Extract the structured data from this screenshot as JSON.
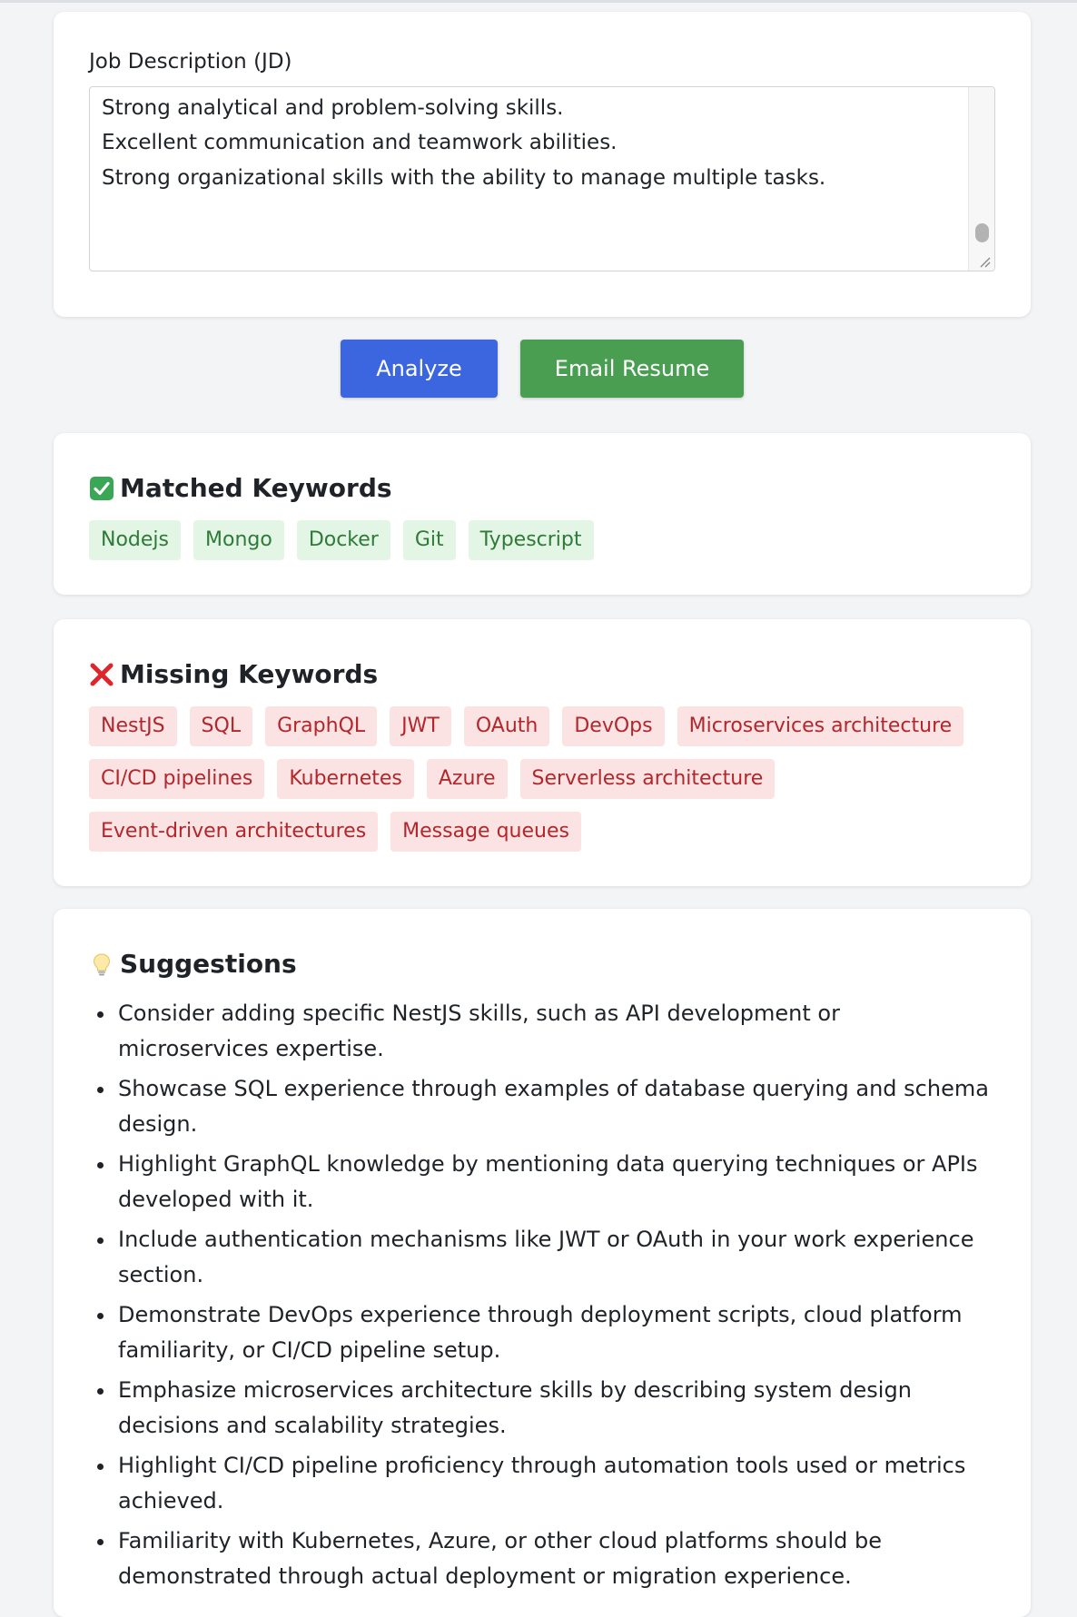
{
  "jd": {
    "label": "Job Description (JD)",
    "text": "Overview\n\nSoft Skills:\n\nStrong analytical and problem-solving skills.\nExcellent communication and teamwork abilities.\nStrong organizational skills with the ability to manage multiple tasks."
  },
  "actions": {
    "analyze_label": "Analyze",
    "email_label": "Email Resume"
  },
  "matched": {
    "title": "Matched Keywords",
    "icon": "check-mark-icon",
    "keywords": [
      "Nodejs",
      "Mongo",
      "Docker",
      "Git",
      "Typescript"
    ]
  },
  "missing": {
    "title": "Missing Keywords",
    "icon": "cross-mark-icon",
    "keywords": [
      "NestJS",
      "SQL",
      "GraphQL",
      "JWT",
      "OAuth",
      "DevOps",
      "Microservices architecture",
      "CI/CD pipelines",
      "Kubernetes",
      "Azure",
      "Serverless architecture",
      "Event-driven architectures",
      "Message queues"
    ]
  },
  "suggestions": {
    "title": "Suggestions",
    "icon": "lightbulb-icon",
    "items": [
      "Consider adding specific NestJS skills, such as API development or microservices expertise.",
      "Showcase SQL experience through examples of database querying and schema design.",
      "Highlight GraphQL knowledge by mentioning data querying techniques or APIs developed with it.",
      "Include authentication mechanisms like JWT or OAuth in your work experience section.",
      "Demonstrate DevOps experience through deployment scripts, cloud platform familiarity, or CI/CD pipeline setup.",
      "Emphasize microservices architecture skills by describing system design decisions and scalability strategies.",
      "Highlight CI/CD pipeline proficiency through automation tools used or metrics achieved.",
      "Familiarity with Kubernetes, Azure, or other cloud platforms should be demonstrated through actual deployment or migration experience."
    ]
  },
  "colors": {
    "analyze_button": "#3c66e0",
    "email_button": "#4a9e51",
    "matched_tag_bg": "#e3f5e4",
    "matched_tag_text": "#2f7a37",
    "missing_tag_bg": "#fbe3e3",
    "missing_tag_text": "#b3262b"
  }
}
